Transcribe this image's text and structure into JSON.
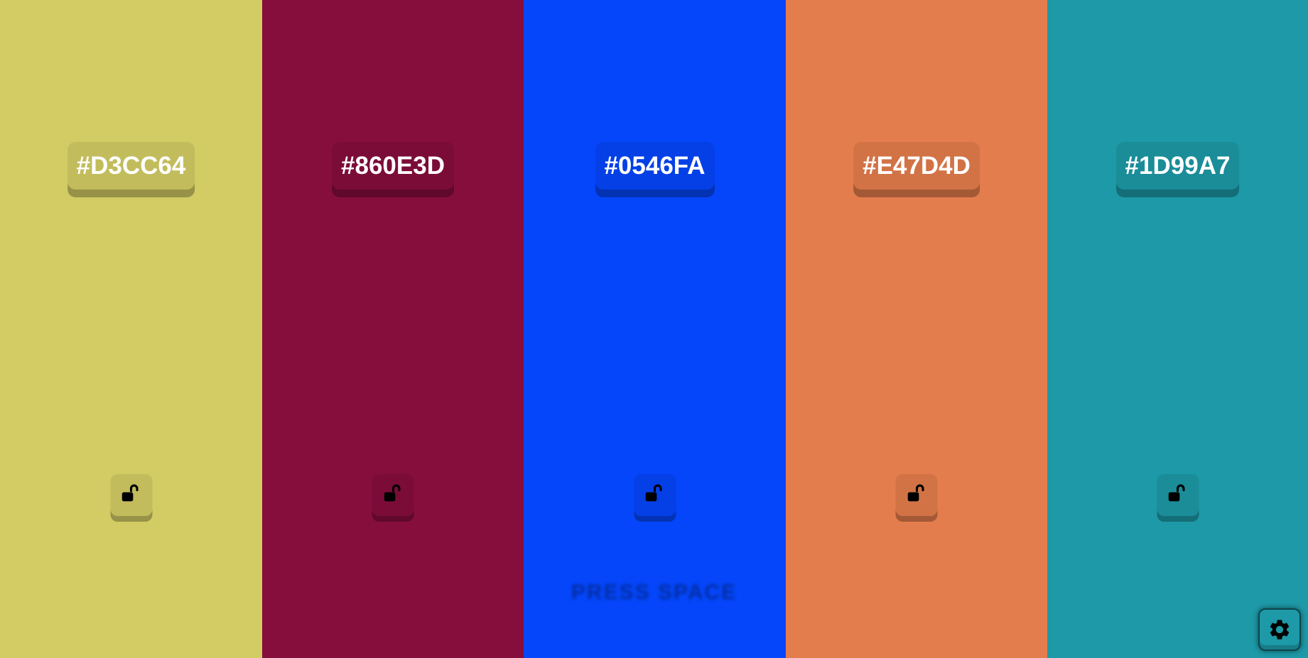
{
  "palette": [
    {
      "hex": "#D3CC64",
      "color": "#D3CC64",
      "locked": false,
      "lock_icon": "unlocked-padlock-icon"
    },
    {
      "hex": "#860E3D",
      "color": "#860E3D",
      "locked": false,
      "lock_icon": "unlocked-padlock-icon"
    },
    {
      "hex": "#0546FA",
      "color": "#0546FA",
      "locked": false,
      "lock_icon": "unlocked-padlock-icon"
    },
    {
      "hex": "#E47D4D",
      "color": "#E47D4D",
      "locked": false,
      "lock_icon": "unlocked-padlock-icon"
    },
    {
      "hex": "#1D99A7",
      "color": "#1D99A7",
      "locked": false,
      "lock_icon": "unlocked-padlock-icon"
    }
  ],
  "hint": "PRESS SPACE",
  "settings": {
    "icon": "gear-icon",
    "color": "#1D99A7"
  }
}
